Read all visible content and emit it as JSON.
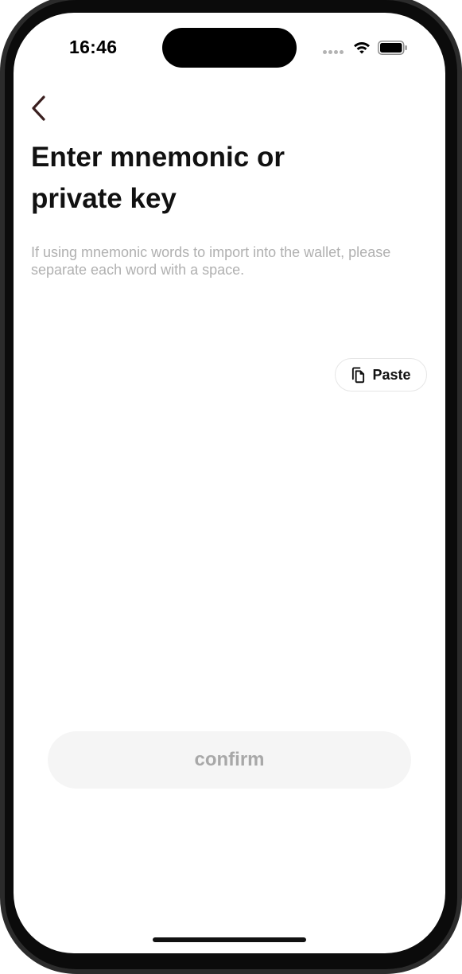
{
  "status_bar": {
    "time": "16:46",
    "icons": [
      "cellular-signal-icon",
      "wifi-icon",
      "battery-icon"
    ]
  },
  "nav": {
    "back_icon": "chevron-left-icon"
  },
  "page": {
    "title": "Enter mnemonic or private key",
    "hint": "If using mnemonic words to import into the wallet, please separate each word with a space."
  },
  "input": {
    "value": ""
  },
  "paste_button": {
    "label": "Paste",
    "icon": "clipboard-icon"
  },
  "confirm_button": {
    "label": "confirm",
    "enabled": false
  },
  "colors": {
    "title": "#111111",
    "hint": "#b0b0b0",
    "back_chevron": "#3a1f1f",
    "confirm_bg_disabled": "#f5f5f5",
    "confirm_text_disabled": "#a8a8a8"
  }
}
